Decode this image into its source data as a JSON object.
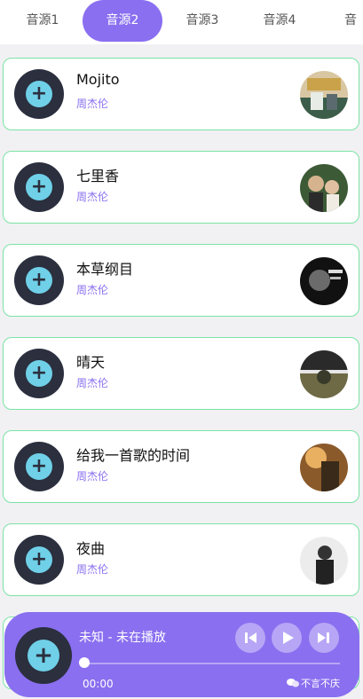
{
  "tabs": [
    {
      "label": "音源1"
    },
    {
      "label": "音源2"
    },
    {
      "label": "音源3"
    },
    {
      "label": "音源4"
    },
    {
      "label": "音"
    }
  ],
  "active_tab": 1,
  "songs": [
    {
      "title": "Mojito",
      "artist": "周杰伦"
    },
    {
      "title": "七里香",
      "artist": "周杰伦"
    },
    {
      "title": "本草纲目",
      "artist": "周杰伦"
    },
    {
      "title": "晴天",
      "artist": "周杰伦"
    },
    {
      "title": "给我一首歌的时间",
      "artist": "周杰伦"
    },
    {
      "title": "夜曲",
      "artist": "周杰伦"
    }
  ],
  "player": {
    "title": "未知 - 未在播放",
    "time": "00:00",
    "progress": 0
  },
  "watermark": "不言不庆",
  "colors": {
    "accent": "#8a6ff0",
    "disc": "#2b2f3e",
    "disc_center": "#6fd0e8",
    "card_border": "#7be3a4"
  }
}
